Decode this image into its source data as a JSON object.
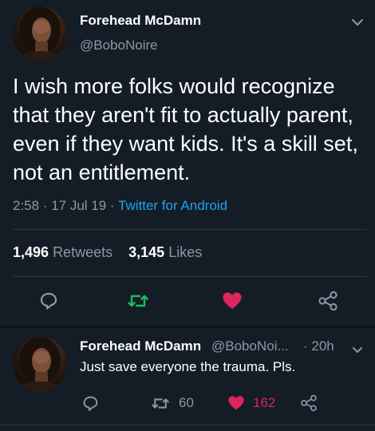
{
  "main_tweet": {
    "name": "Forehead McDamn",
    "handle": "@BoboNoire",
    "text": "I wish more folks would recognize that they aren't fit to actually parent, even if they want kids. It's a skill set, not an entitlement.",
    "time": "2:58",
    "dot1": " · ",
    "date": "17 Jul 19",
    "dot2": " · ",
    "source": "Twitter for Android",
    "retweets_count": "1,496",
    "retweets_label": "Retweets",
    "likes_count": "3,145",
    "likes_label": "Likes"
  },
  "reply_tweet": {
    "name": "Forehead McDamn",
    "handle": "@BoboNoi...",
    "time": "· 20h",
    "text": "Just save everyone the trauma. Pls.",
    "retweets_count": "60",
    "likes_count": "162"
  },
  "colors": {
    "background": "#141d26",
    "secondary_text": "#8899a6",
    "link": "#1da1f2",
    "retweet_green": "#17bf63",
    "like_red": "#e0245e"
  },
  "icons": {
    "reply": "reply-icon",
    "retweet": "retweet-icon",
    "like": "heart-icon",
    "share": "share-icon",
    "menu": "chevron-down-icon"
  }
}
